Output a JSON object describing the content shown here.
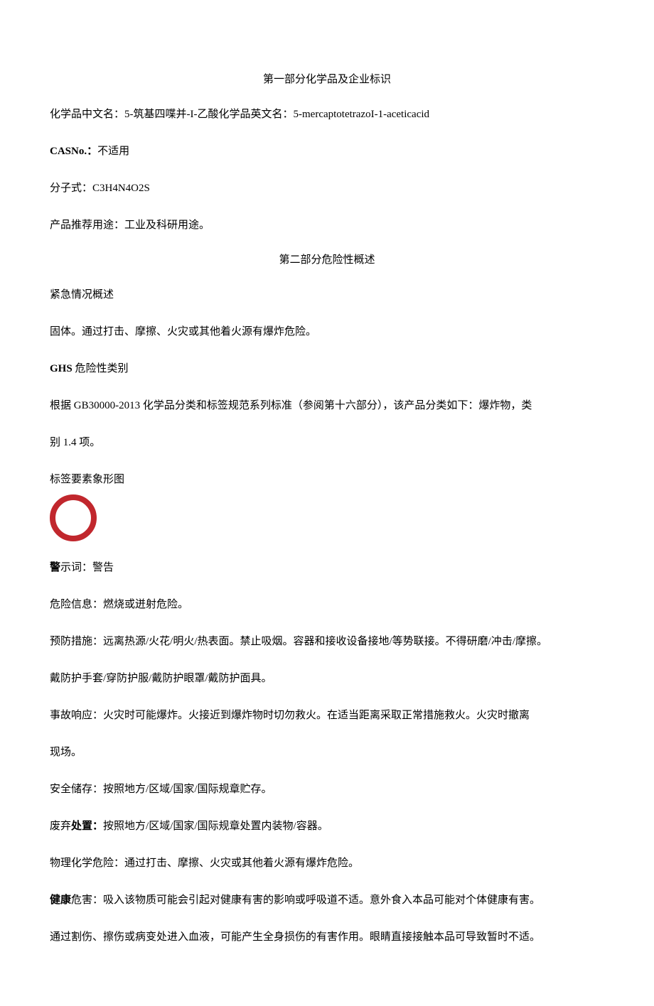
{
  "section1": {
    "title": "第一部分化学品及企业标识",
    "name_line_prefix": "化学品中文名：",
    "name_line_cn": "5-筑基四喋并-I-乙酸化学品英文名：5-mercaptotetrazoI-1-aceticacid",
    "cas_label": "CASNo.：",
    "cas_value": "不适用",
    "formula_label": "分子式：",
    "formula_value": "C3H4N4O2S",
    "use_label": "产品推荐用途：",
    "use_value": "工业及科研用途。"
  },
  "section2": {
    "title": "第二部分危险性概述",
    "emergency_heading": "紧急情况概述",
    "emergency_body": "固体。通过打击、摩擦、火灾或其他着火源有爆炸危险。",
    "ghs_label": "GHS",
    "ghs_suffix": " 危险性类别",
    "ghs_body1": "根据 GB30000-2013 化学品分类和标签规范系列标准（参阅第十六部分），该产品分类如下：爆炸物，类",
    "ghs_body2": "别 1.4 项。",
    "pictogram_label": "标签要素象形图",
    "signal_bold": "警",
    "signal_rest": "示词：警告",
    "hazard_info": "危险信息：燃烧或迸射危险。",
    "prevent1": "预防措施：远离热源/火花/明火/热表面。禁止吸烟。容器和接收设备接地/等势联接。不得研磨/冲击/摩擦。",
    "prevent2": "戴防护手套/穿防护服/戴防护眼罩/戴防护面具。",
    "response1": "事故响应：火灾时可能爆炸。火接近到爆炸物时切勿救火。在适当距离采取正常措施救火。火灾时撤离",
    "response2": "现场。",
    "storage": "安全储存：按照地方/区域/国家/国际规章贮存。",
    "disposal_prefix": "废弃",
    "disposal_bold": "处置：",
    "disposal_rest": "按照地方/区域/国家/国际规章处置内装物/容器。",
    "physchem": "物理化学危险：通过打击、摩擦、火灾或其他着火源有爆炸危险。",
    "health_bold": "健康",
    "health_rest": "危害：吸入该物质可能会引起对健康有害的影响或呼吸道不适。意外食入本品可能对个体健康有害。",
    "health2": "通过割伤、擦伤或病变处进入血液，可能产生全身损伤的有害作用。眼睛直接接触本品可导致暂时不适。"
  }
}
